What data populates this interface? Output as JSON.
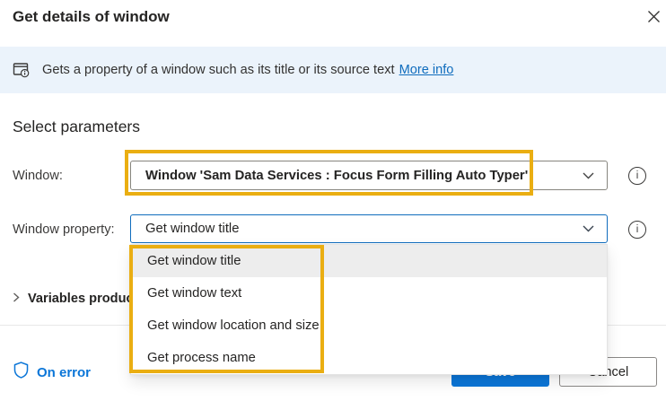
{
  "header": {
    "title": "Get details of window"
  },
  "infobar": {
    "text": "Gets a property of a window such as its title or its source text",
    "link_label": "More info"
  },
  "parameters": {
    "heading": "Select parameters",
    "window": {
      "label": "Window:",
      "value": "Window 'Sam Data Services : Focus Form Filling Auto Typer'"
    },
    "window_property": {
      "label": "Window property:",
      "value": "Get window title",
      "selected_option": "Get window title",
      "options": [
        "Get window title",
        "Get window text",
        "Get window location and size",
        "Get process name"
      ]
    }
  },
  "expander": {
    "label": "Variables produced"
  },
  "footer": {
    "on_error_label": "On error",
    "save_label": "Save",
    "cancel_label": "Cancel"
  },
  "icons": {
    "info_glyph": "i"
  },
  "colors": {
    "accent_blue": "#0b76d8",
    "focus_border_blue": "#0f6cbd",
    "annotation_gold": "#eaae12",
    "infobar_bg": "#ebf3fb",
    "link_blue": "#0f6cbd",
    "selected_item_bg": "#ededed"
  }
}
